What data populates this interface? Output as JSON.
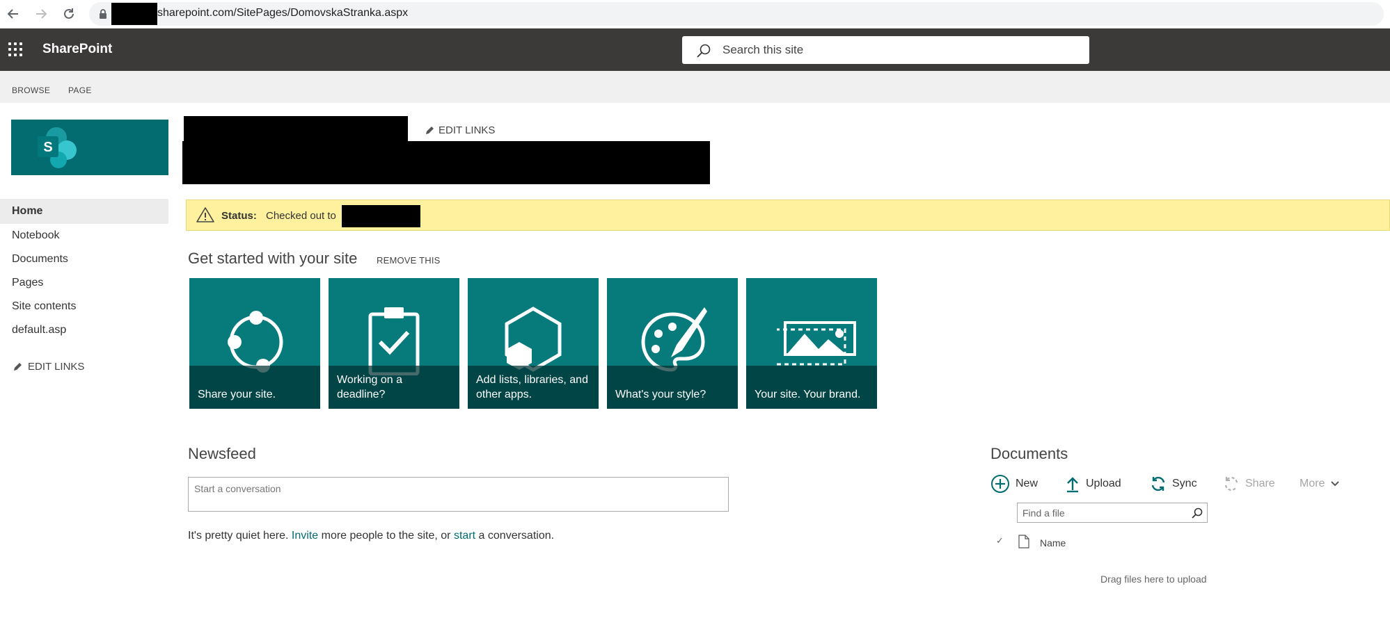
{
  "browser": {
    "url_text": "sharepoint.com/SitePages/DomovskaStranka.aspx"
  },
  "suite_bar": {
    "title": "SharePoint",
    "search_placeholder": "Search this site"
  },
  "ribbon": {
    "tabs": [
      "BROWSE",
      "PAGE"
    ]
  },
  "header": {
    "edit_links": "EDIT LINKS"
  },
  "left_nav": {
    "items": [
      "Home",
      "Notebook",
      "Documents",
      "Pages",
      "Site contents",
      "default.asp"
    ],
    "edit_links": "EDIT LINKS"
  },
  "status": {
    "label": "Status:",
    "text": "Checked out to"
  },
  "get_started": {
    "title": "Get started with your site",
    "remove": "REMOVE THIS",
    "tiles": [
      {
        "caption": "Share your site.",
        "icon": "share-site-icon"
      },
      {
        "caption": "Working on a deadline?",
        "icon": "clipboard-check-icon"
      },
      {
        "caption": "Add lists, libraries, and other apps.",
        "icon": "add-apps-icon"
      },
      {
        "caption": "What's your style?",
        "icon": "palette-icon"
      },
      {
        "caption": "Your site. Your brand.",
        "icon": "brand-image-icon"
      }
    ]
  },
  "newsfeed": {
    "title": "Newsfeed",
    "placeholder": "Start a conversation",
    "quiet_prefix": "It's pretty quiet here.",
    "invite_link": "Invite",
    "quiet_middle": "more people to the site, or",
    "start_link": "start",
    "quiet_suffix": "a conversation."
  },
  "documents": {
    "title": "Documents",
    "commands": {
      "new": "New",
      "upload": "Upload",
      "sync": "Sync",
      "share": "Share",
      "more": "More"
    },
    "find_placeholder": "Find a file",
    "column_name": "Name",
    "drag_text": "Drag files here to upload"
  },
  "colors": {
    "suite_bar": "#3b3a39",
    "accent": "#036c70",
    "tile": "#077a7c",
    "status_bg": "#fff19d"
  }
}
